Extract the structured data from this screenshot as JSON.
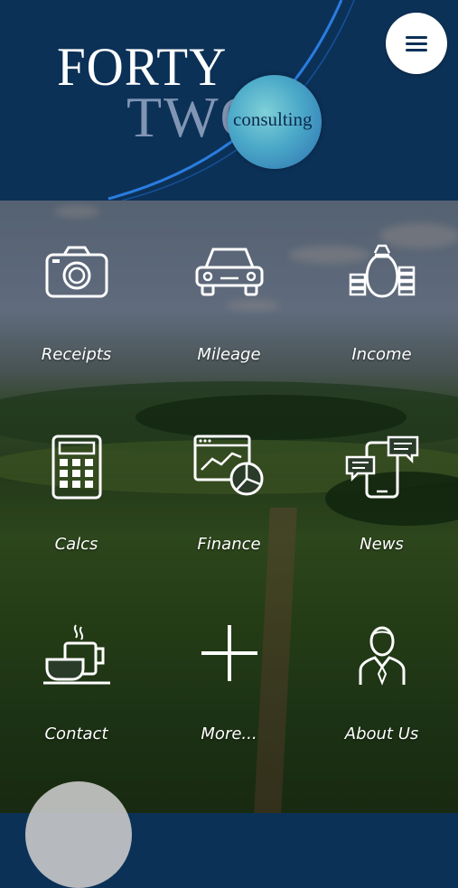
{
  "header": {
    "logo_line1": "FORTY",
    "logo_line2": "TWO",
    "logo_sub": "consulting",
    "menu_icon": "hamburger-menu-icon"
  },
  "tiles": [
    {
      "label": "Receipts",
      "icon": "camera-icon"
    },
    {
      "label": "Mileage",
      "icon": "car-icon"
    },
    {
      "label": "Income",
      "icon": "money-bag-icon"
    },
    {
      "label": "Calcs",
      "icon": "calculator-icon"
    },
    {
      "label": "Finance",
      "icon": "finance-chart-icon"
    },
    {
      "label": "News",
      "icon": "news-phone-icon"
    },
    {
      "label": "Contact",
      "icon": "coffee-cup-icon"
    },
    {
      "label": "More...",
      "icon": "plus-icon"
    },
    {
      "label": "About Us",
      "icon": "person-icon"
    }
  ],
  "colors": {
    "header_bg": "#0c3157",
    "accent_blue": "#1e6fd9",
    "orb": "#4ba9c8"
  }
}
